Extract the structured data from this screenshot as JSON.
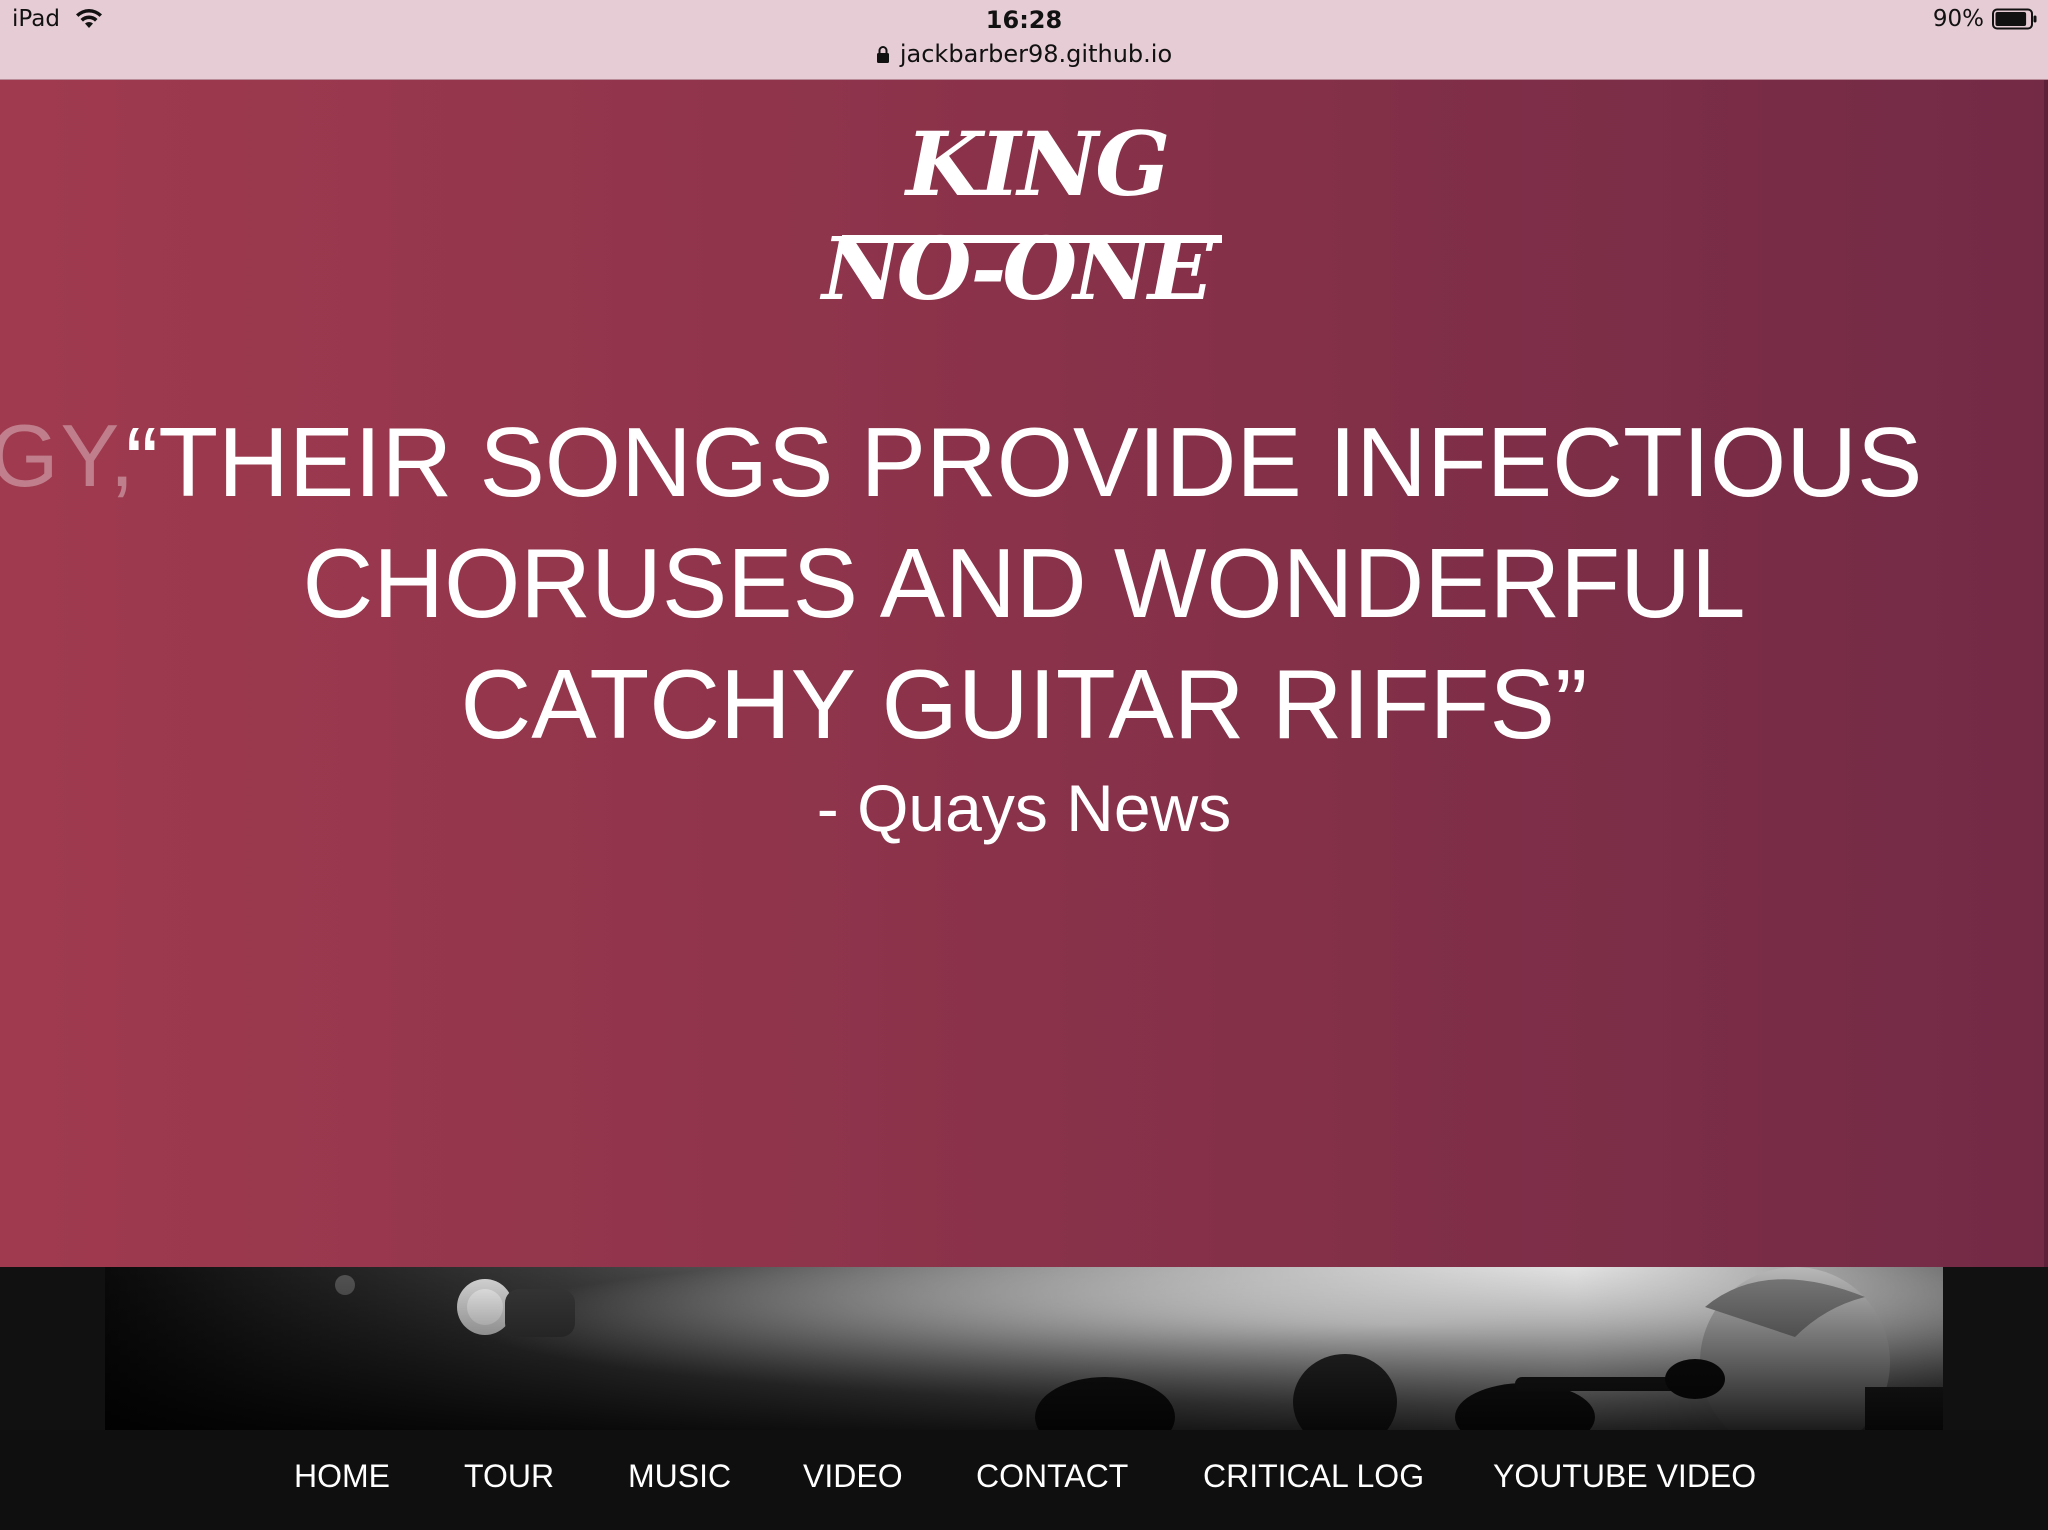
{
  "status_bar": {
    "device": "iPad",
    "time": "16:28",
    "url": "jackbarber98.github.io",
    "battery": "90%",
    "battery_level": 0.9,
    "icons": [
      "wifi-icon",
      "lock-icon",
      "battery-icon"
    ]
  },
  "hero": {
    "logo_line1": "KING",
    "logo_line2": "NO-ONE",
    "ghost_text": "GY,",
    "quote_line1": "“THEIR SONGS PROVIDE INFECTIOUS",
    "quote_line2": "CHORUSES AND WONDERFUL",
    "quote_line3": "CATCHY GUITAR RIFFS”",
    "quote_source": "- Quays News",
    "gradient_start": "#a03a4f",
    "gradient_end": "#732a45"
  },
  "nav": {
    "items": [
      "HOME",
      "TOUR",
      "MUSIC",
      "VIDEO",
      "CONTACT",
      "CRITICAL LOG",
      "YOUTUBE VIDEO"
    ]
  }
}
